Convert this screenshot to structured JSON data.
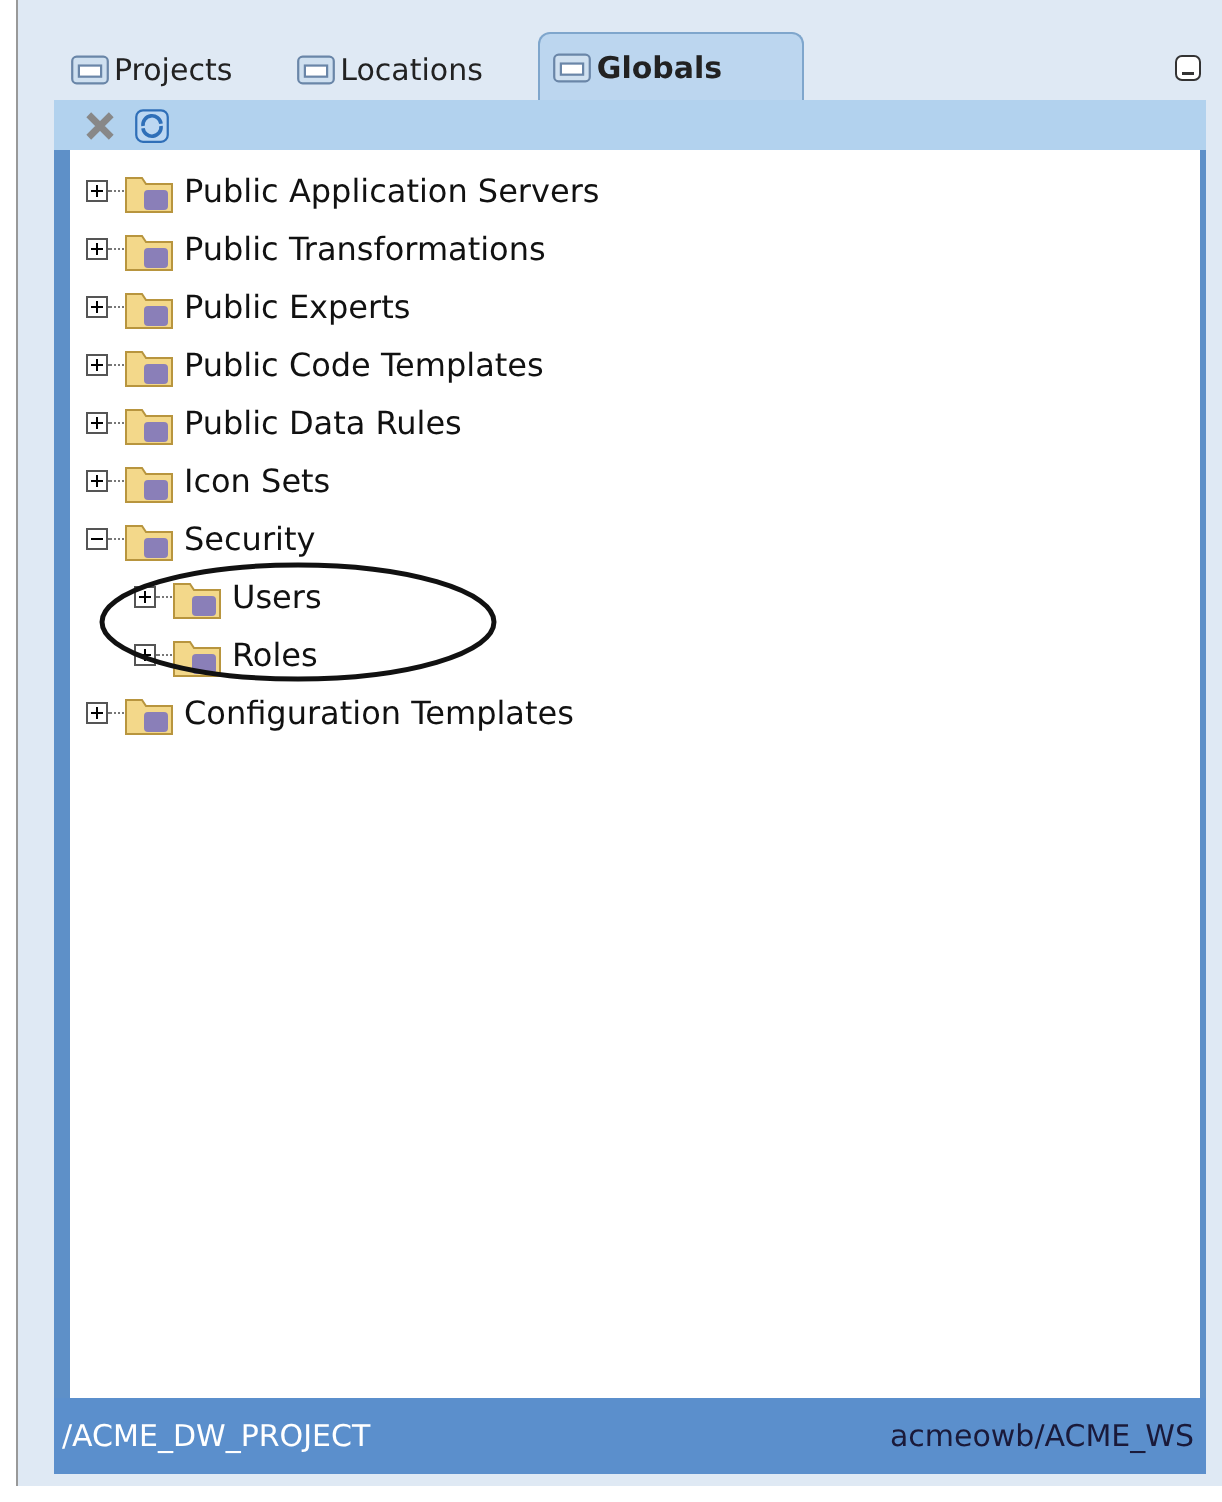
{
  "tabs": [
    {
      "label": "Projects",
      "selected": false
    },
    {
      "label": "Locations",
      "selected": false
    },
    {
      "label": "Globals",
      "selected": true
    }
  ],
  "tree": [
    {
      "label": "Public Application Servers",
      "expanded": false
    },
    {
      "label": "Public Transformations",
      "expanded": false
    },
    {
      "label": "Public Experts",
      "expanded": false
    },
    {
      "label": "Public Code Templates",
      "expanded": false
    },
    {
      "label": "Public Data Rules",
      "expanded": false
    },
    {
      "label": "Icon Sets",
      "expanded": false
    },
    {
      "label": "Security",
      "expanded": true,
      "children": [
        {
          "label": "Users",
          "expanded": false
        },
        {
          "label": "Roles",
          "expanded": false
        }
      ]
    },
    {
      "label": "Configuration Templates",
      "expanded": false
    }
  ],
  "status_bar": {
    "project": "/ACME_DW_PROJECT",
    "workspace": "acmeowb/ACME_WS"
  }
}
